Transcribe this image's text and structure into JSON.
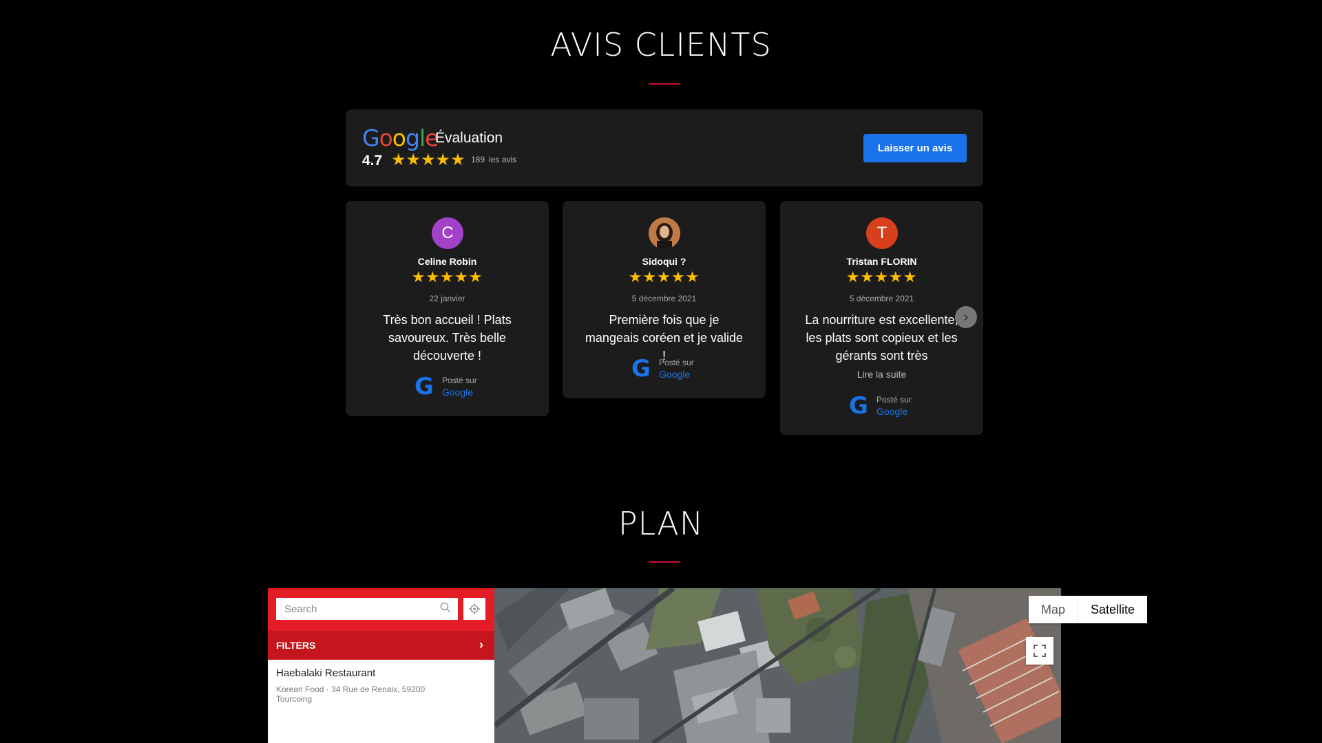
{
  "reviews_section": {
    "title": "AVIS CLIENTS"
  },
  "google_summary": {
    "logo_letters": [
      "G",
      "o",
      "o",
      "g",
      "l",
      "e"
    ],
    "logo_colors": [
      "#4285f4",
      "#ea4335",
      "#fbbc04",
      "#4285f4",
      "#34a853",
      "#ea4335"
    ],
    "label": "Évaluation",
    "rating": "4.7",
    "stars": "★★★★★",
    "review_count": "189",
    "review_count_suffix": "les avis",
    "cta": "Laisser un avis"
  },
  "reviews": [
    {
      "initial": "C",
      "avatar_color": "#a142c8",
      "name": "Celine Robin",
      "stars": "★★★★★",
      "date": "22 janvier",
      "text": "Très bon accueil ! Plats savoureux. Très belle découverte !",
      "read_more": "",
      "posted_label": "Posté sur",
      "posted_source": "Google"
    },
    {
      "initial": "",
      "avatar_color": "#b06a3a",
      "name": "Sidoqui ?",
      "stars": "★★★★★",
      "date": "5 décembre 2021",
      "text": "Première fois que je mangeais coréen et je valide !",
      "read_more": "",
      "posted_label": "Posté sur",
      "posted_source": "Google"
    },
    {
      "initial": "T",
      "avatar_color": "#d8401c",
      "name": "Tristan FLORIN",
      "stars": "★★★★★",
      "date": "5 décembre 2021",
      "text": "La nourriture est excellente, les plats sont copieux et les gérants sont très",
      "read_more": "Lire la suite",
      "posted_label": "Posté sur",
      "posted_source": "Google"
    }
  ],
  "plan_section": {
    "title": "PLAN"
  },
  "map": {
    "search_placeholder": "Search",
    "filters_label": "FILTERS",
    "place_name": "Haebalaki Restaurant",
    "place_details": "Korean Food · 34 Rue de Renaix, 59200",
    "place_city": "Tourcoing",
    "map_type_map": "Map",
    "map_type_satellite": "Satellite"
  }
}
